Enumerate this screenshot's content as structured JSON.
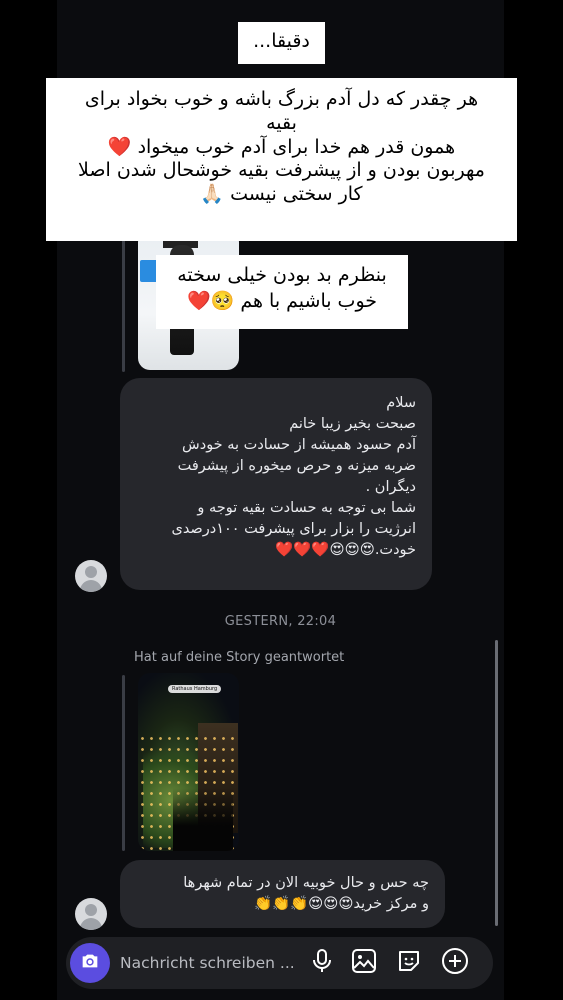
{
  "overlays": {
    "title": "دقیقا...",
    "main_lines": [
      "هر چقدر که دل آدم بزرگ باشه و خوب بخواد برای",
      "بقیه",
      "همون قدر هم خدا برای آدم خوب میخواد ❤️",
      "مهربون بودن و از پیشرفت بقیه خوشحال شدن اصلا",
      "کار سختی نیست 🙏🏻"
    ],
    "small_lines": [
      "بنظرم بد بودن خیلی سخته",
      "خوب باشیم با هم 🥺❤️"
    ]
  },
  "messages": {
    "bubble1_lines": [
      "سلام",
      "صبحت بخیر زیبا خانم",
      "آدم حسود همیشه از حسادت به خودش",
      "ضربه میزنه و حرص میخوره از پیشرفت",
      "دیگران .",
      "شما بی توجه به حسادت بقیه توجه و",
      "انرژیت را بزار برای پیشرفت ۱۰۰درصدی",
      "خودت.😍😍😍❤️❤️❤️"
    ],
    "timestamp": "GESTERN, 22:04",
    "reply_label": "Hat auf deine Story geantwortet",
    "story_tag": "Rathaus Hamburg",
    "bubble2_lines": [
      "چه حس و حال خوبیه الان در تمام شهرها",
      "و مرکز خرید😍😍😍👏👏👏"
    ]
  },
  "composer": {
    "placeholder": "Nachricht schreiben ..."
  },
  "icons": {
    "camera": "camera-icon",
    "mic": "microphone-icon",
    "gallery": "image-icon",
    "sticker": "sticker-icon",
    "plus": "plus-circle-icon"
  },
  "colors": {
    "background": "#000000",
    "chat_bg": "#0b0c0f",
    "bubble": "#26272c",
    "accent": "#5b4de0"
  }
}
